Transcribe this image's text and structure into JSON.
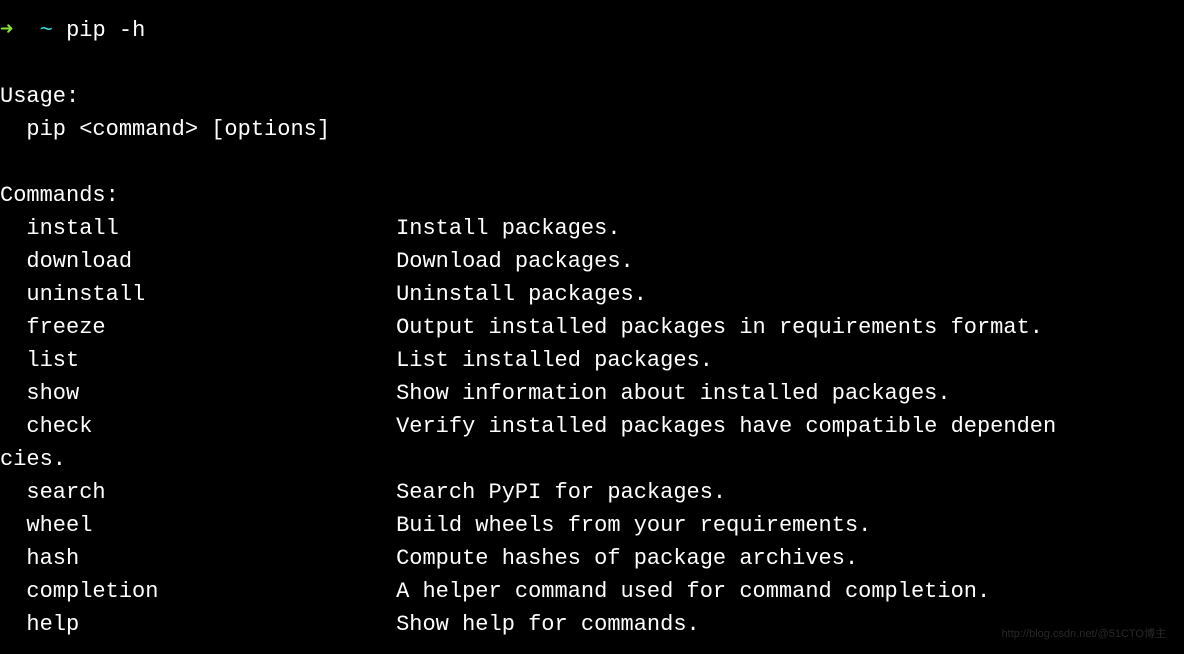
{
  "prompt": {
    "arrow": "➜",
    "path": "~",
    "command": "pip -h"
  },
  "usage": {
    "header": "Usage:",
    "line": "  pip <command> [options]"
  },
  "commands": {
    "header": "Commands:",
    "items": [
      {
        "name": "install",
        "desc": "Install packages."
      },
      {
        "name": "download",
        "desc": "Download packages."
      },
      {
        "name": "uninstall",
        "desc": "Uninstall packages."
      },
      {
        "name": "freeze",
        "desc": "Output installed packages in requirements format."
      },
      {
        "name": "list",
        "desc": "List installed packages."
      },
      {
        "name": "show",
        "desc": "Show information about installed packages."
      },
      {
        "name": "check",
        "desc": "Verify installed packages have compatible dependen"
      },
      {
        "name_wrap": "cies."
      },
      {
        "name": "search",
        "desc": "Search PyPI for packages."
      },
      {
        "name": "wheel",
        "desc": "Build wheels from your requirements."
      },
      {
        "name": "hash",
        "desc": "Compute hashes of package archives."
      },
      {
        "name": "completion",
        "desc": "A helper command used for command completion."
      },
      {
        "name": "help",
        "desc": "Show help for commands."
      }
    ]
  },
  "watermark": "http://blog.csdn.net/@51CTO博主"
}
